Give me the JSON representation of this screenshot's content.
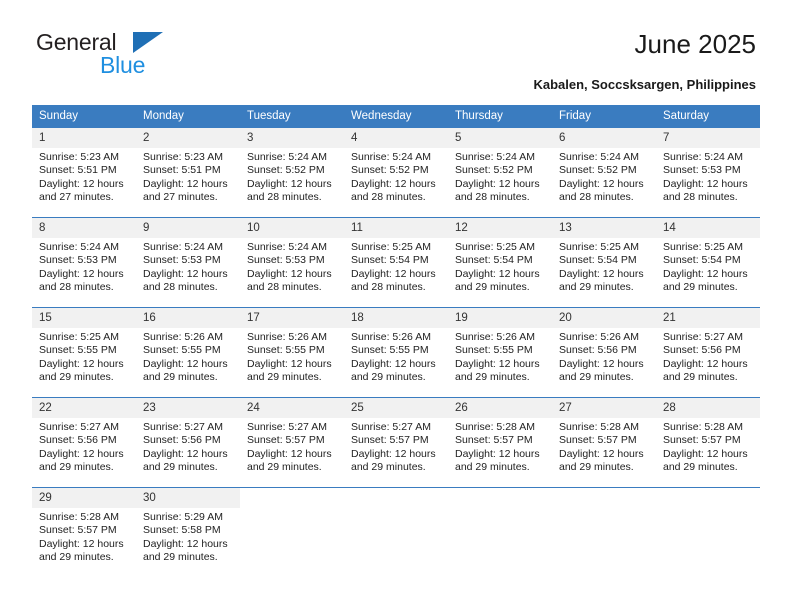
{
  "brand": {
    "name_top": "General",
    "name_bottom": "Blue",
    "triangle_color": "#1f6fb5",
    "bottom_color": "#1f8fe0"
  },
  "header": {
    "title": "June 2025",
    "location": "Kabalen, Soccsksargen, Philippines",
    "accent_color": "#3a7cc0"
  },
  "weekdays": [
    "Sunday",
    "Monday",
    "Tuesday",
    "Wednesday",
    "Thursday",
    "Friday",
    "Saturday"
  ],
  "labels": {
    "sunrise": "Sunrise:",
    "sunset": "Sunset:",
    "daylight": "Daylight:"
  },
  "weeks": [
    [
      {
        "day": "1",
        "sunrise": "Sunrise: 5:23 AM",
        "sunset": "Sunset: 5:51 PM",
        "daylight_line1": "Daylight: 12 hours",
        "daylight_line2": "and 27 minutes."
      },
      {
        "day": "2",
        "sunrise": "Sunrise: 5:23 AM",
        "sunset": "Sunset: 5:51 PM",
        "daylight_line1": "Daylight: 12 hours",
        "daylight_line2": "and 27 minutes."
      },
      {
        "day": "3",
        "sunrise": "Sunrise: 5:24 AM",
        "sunset": "Sunset: 5:52 PM",
        "daylight_line1": "Daylight: 12 hours",
        "daylight_line2": "and 28 minutes."
      },
      {
        "day": "4",
        "sunrise": "Sunrise: 5:24 AM",
        "sunset": "Sunset: 5:52 PM",
        "daylight_line1": "Daylight: 12 hours",
        "daylight_line2": "and 28 minutes."
      },
      {
        "day": "5",
        "sunrise": "Sunrise: 5:24 AM",
        "sunset": "Sunset: 5:52 PM",
        "daylight_line1": "Daylight: 12 hours",
        "daylight_line2": "and 28 minutes."
      },
      {
        "day": "6",
        "sunrise": "Sunrise: 5:24 AM",
        "sunset": "Sunset: 5:52 PM",
        "daylight_line1": "Daylight: 12 hours",
        "daylight_line2": "and 28 minutes."
      },
      {
        "day": "7",
        "sunrise": "Sunrise: 5:24 AM",
        "sunset": "Sunset: 5:53 PM",
        "daylight_line1": "Daylight: 12 hours",
        "daylight_line2": "and 28 minutes."
      }
    ],
    [
      {
        "day": "8",
        "sunrise": "Sunrise: 5:24 AM",
        "sunset": "Sunset: 5:53 PM",
        "daylight_line1": "Daylight: 12 hours",
        "daylight_line2": "and 28 minutes."
      },
      {
        "day": "9",
        "sunrise": "Sunrise: 5:24 AM",
        "sunset": "Sunset: 5:53 PM",
        "daylight_line1": "Daylight: 12 hours",
        "daylight_line2": "and 28 minutes."
      },
      {
        "day": "10",
        "sunrise": "Sunrise: 5:24 AM",
        "sunset": "Sunset: 5:53 PM",
        "daylight_line1": "Daylight: 12 hours",
        "daylight_line2": "and 28 minutes."
      },
      {
        "day": "11",
        "sunrise": "Sunrise: 5:25 AM",
        "sunset": "Sunset: 5:54 PM",
        "daylight_line1": "Daylight: 12 hours",
        "daylight_line2": "and 28 minutes."
      },
      {
        "day": "12",
        "sunrise": "Sunrise: 5:25 AM",
        "sunset": "Sunset: 5:54 PM",
        "daylight_line1": "Daylight: 12 hours",
        "daylight_line2": "and 29 minutes."
      },
      {
        "day": "13",
        "sunrise": "Sunrise: 5:25 AM",
        "sunset": "Sunset: 5:54 PM",
        "daylight_line1": "Daylight: 12 hours",
        "daylight_line2": "and 29 minutes."
      },
      {
        "day": "14",
        "sunrise": "Sunrise: 5:25 AM",
        "sunset": "Sunset: 5:54 PM",
        "daylight_line1": "Daylight: 12 hours",
        "daylight_line2": "and 29 minutes."
      }
    ],
    [
      {
        "day": "15",
        "sunrise": "Sunrise: 5:25 AM",
        "sunset": "Sunset: 5:55 PM",
        "daylight_line1": "Daylight: 12 hours",
        "daylight_line2": "and 29 minutes."
      },
      {
        "day": "16",
        "sunrise": "Sunrise: 5:26 AM",
        "sunset": "Sunset: 5:55 PM",
        "daylight_line1": "Daylight: 12 hours",
        "daylight_line2": "and 29 minutes."
      },
      {
        "day": "17",
        "sunrise": "Sunrise: 5:26 AM",
        "sunset": "Sunset: 5:55 PM",
        "daylight_line1": "Daylight: 12 hours",
        "daylight_line2": "and 29 minutes."
      },
      {
        "day": "18",
        "sunrise": "Sunrise: 5:26 AM",
        "sunset": "Sunset: 5:55 PM",
        "daylight_line1": "Daylight: 12 hours",
        "daylight_line2": "and 29 minutes."
      },
      {
        "day": "19",
        "sunrise": "Sunrise: 5:26 AM",
        "sunset": "Sunset: 5:55 PM",
        "daylight_line1": "Daylight: 12 hours",
        "daylight_line2": "and 29 minutes."
      },
      {
        "day": "20",
        "sunrise": "Sunrise: 5:26 AM",
        "sunset": "Sunset: 5:56 PM",
        "daylight_line1": "Daylight: 12 hours",
        "daylight_line2": "and 29 minutes."
      },
      {
        "day": "21",
        "sunrise": "Sunrise: 5:27 AM",
        "sunset": "Sunset: 5:56 PM",
        "daylight_line1": "Daylight: 12 hours",
        "daylight_line2": "and 29 minutes."
      }
    ],
    [
      {
        "day": "22",
        "sunrise": "Sunrise: 5:27 AM",
        "sunset": "Sunset: 5:56 PM",
        "daylight_line1": "Daylight: 12 hours",
        "daylight_line2": "and 29 minutes."
      },
      {
        "day": "23",
        "sunrise": "Sunrise: 5:27 AM",
        "sunset": "Sunset: 5:56 PM",
        "daylight_line1": "Daylight: 12 hours",
        "daylight_line2": "and 29 minutes."
      },
      {
        "day": "24",
        "sunrise": "Sunrise: 5:27 AM",
        "sunset": "Sunset: 5:57 PM",
        "daylight_line1": "Daylight: 12 hours",
        "daylight_line2": "and 29 minutes."
      },
      {
        "day": "25",
        "sunrise": "Sunrise: 5:27 AM",
        "sunset": "Sunset: 5:57 PM",
        "daylight_line1": "Daylight: 12 hours",
        "daylight_line2": "and 29 minutes."
      },
      {
        "day": "26",
        "sunrise": "Sunrise: 5:28 AM",
        "sunset": "Sunset: 5:57 PM",
        "daylight_line1": "Daylight: 12 hours",
        "daylight_line2": "and 29 minutes."
      },
      {
        "day": "27",
        "sunrise": "Sunrise: 5:28 AM",
        "sunset": "Sunset: 5:57 PM",
        "daylight_line1": "Daylight: 12 hours",
        "daylight_line2": "and 29 minutes."
      },
      {
        "day": "28",
        "sunrise": "Sunrise: 5:28 AM",
        "sunset": "Sunset: 5:57 PM",
        "daylight_line1": "Daylight: 12 hours",
        "daylight_line2": "and 29 minutes."
      }
    ],
    [
      {
        "day": "29",
        "sunrise": "Sunrise: 5:28 AM",
        "sunset": "Sunset: 5:57 PM",
        "daylight_line1": "Daylight: 12 hours",
        "daylight_line2": "and 29 minutes."
      },
      {
        "day": "30",
        "sunrise": "Sunrise: 5:29 AM",
        "sunset": "Sunset: 5:58 PM",
        "daylight_line1": "Daylight: 12 hours",
        "daylight_line2": "and 29 minutes."
      },
      {
        "day": "",
        "sunrise": "",
        "sunset": "",
        "daylight_line1": "",
        "daylight_line2": ""
      },
      {
        "day": "",
        "sunrise": "",
        "sunset": "",
        "daylight_line1": "",
        "daylight_line2": ""
      },
      {
        "day": "",
        "sunrise": "",
        "sunset": "",
        "daylight_line1": "",
        "daylight_line2": ""
      },
      {
        "day": "",
        "sunrise": "",
        "sunset": "",
        "daylight_line1": "",
        "daylight_line2": ""
      },
      {
        "day": "",
        "sunrise": "",
        "sunset": "",
        "daylight_line1": "",
        "daylight_line2": ""
      }
    ]
  ]
}
